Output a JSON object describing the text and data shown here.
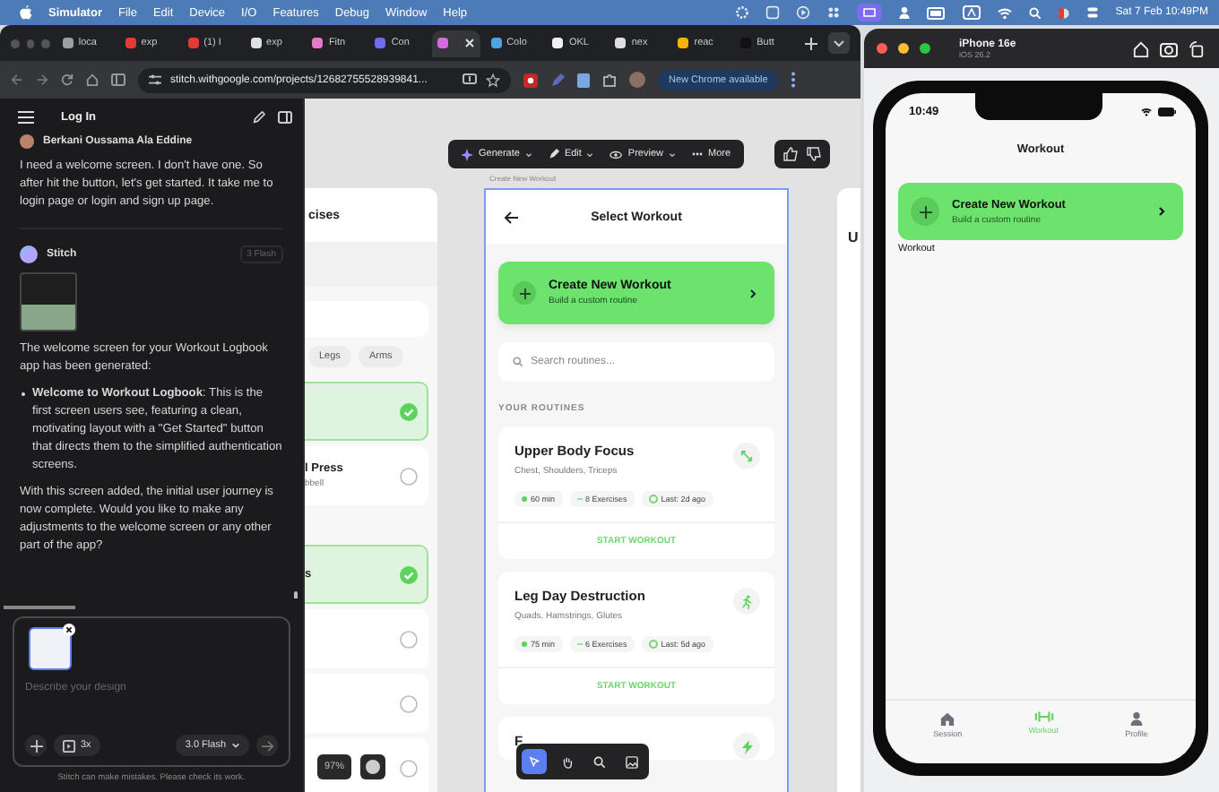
{
  "menubar": {
    "app": "Simulator",
    "menus": [
      "File",
      "Edit",
      "Device",
      "I/O",
      "Features",
      "Debug",
      "Window",
      "Help"
    ],
    "clock": "Sat 7 Feb  10:49PM"
  },
  "browser": {
    "tabs": [
      {
        "label": "loca",
        "color": "#9aa0a6",
        "selected": false
      },
      {
        "label": "exp",
        "color": "#e53935",
        "selected": false
      },
      {
        "label": "(1) I",
        "color": "#e53935",
        "selected": false
      },
      {
        "label": "exp",
        "color": "#e0e0e0",
        "selected": false
      },
      {
        "label": "Fitn",
        "color": "#e879c9",
        "selected": false
      },
      {
        "label": "Con",
        "color": "#6d6df0",
        "selected": false
      },
      {
        "color": "#d66be0",
        "selected": true
      },
      {
        "label": "Colo",
        "color": "#4fa3e0",
        "selected": false
      },
      {
        "label": "OKL",
        "color": "#f1f1f1",
        "selected": false
      },
      {
        "label": "nex",
        "color": "#e0e0e0",
        "selected": false
      },
      {
        "label": "reac",
        "color": "#f4b400",
        "selected": false
      },
      {
        "label": "Butt",
        "color": "#111111",
        "selected": false
      }
    ],
    "url": "stitch.withgoogle.com/projects/12682755528939841...",
    "update_button": "New Chrome available"
  },
  "chat": {
    "title": "Log In",
    "messages": [
      {
        "kind": "user",
        "author": "Berkani Oussama Ala Eddine",
        "text": "I need a welcome screen. I don't have one. So after hit the button, let's get started. It take me to login page or login and sign up page."
      },
      {
        "kind": "assistant",
        "author": "Stitch",
        "badge": "3 Flash",
        "intro": "The welcome screen for your Workout Logbook app has been generated:",
        "bullets": [
          "**Welcome to Workout Logbook**: This is the first screen users see, featuring a clean, motivating layout with a \"Get Started\" button that directs them to the simplified authentication screens."
        ],
        "outro": "With this screen added, the initial user journey is now complete. Would you like to make any adjustments to the welcome screen or any other part of the app?"
      }
    ],
    "composer": {
      "placeholder": "Describe your design",
      "count": "3x",
      "model": "3.0 Flash"
    },
    "disclaimer": "Stitch can make mistakes. Please check its work."
  },
  "canvas": {
    "toolbar": [
      {
        "kind": "generate",
        "label": "Generate"
      },
      {
        "kind": "edit",
        "label": "Edit"
      },
      {
        "kind": "preview",
        "label": "Preview"
      },
      {
        "kind": "more",
        "label": "More"
      }
    ],
    "left_frame": {
      "title": "cises",
      "chips": [
        "Legs",
        "Arms"
      ],
      "items": [
        {
          "checked": true
        },
        {
          "title": "l Press",
          "subtitle": "bbell",
          "checked": false
        },
        {
          "title": "s",
          "checked": true
        },
        {
          "checked": false
        },
        {
          "checked": false
        },
        {
          "checked": false
        }
      ]
    },
    "frame_label": "Create New Workout",
    "main_frame": {
      "title": "Select Workout",
      "create": {
        "title": "Create New Workout",
        "subtitle": "Build a custom routine"
      },
      "search_placeholder": "Search routines...",
      "section": "YOUR ROUTINES",
      "routines": [
        {
          "kind": "expand",
          "name": "Upper Body Focus",
          "muscles": "Chest, Shoulders, Triceps",
          "duration": "60 min",
          "exercises": "8 Exercises",
          "last": "Last: 2d ago",
          "action": "START WORKOUT"
        },
        {
          "kind": "run",
          "name": "Leg Day Destruction",
          "muscles": "Quads, Hamstrings, Glutes",
          "duration": "75 min",
          "exercises": "6 Exercises",
          "last": "Last: 5d ago",
          "action": "START WORKOUT"
        },
        {
          "kind": "bolt",
          "name": "F"
        }
      ]
    },
    "right_frame": {
      "title": "U"
    },
    "zoom": "97%",
    "tools": [
      {
        "kind": "select",
        "selected": true
      },
      {
        "kind": "hand",
        "selected": false
      },
      {
        "kind": "zoom",
        "selected": false
      },
      {
        "kind": "image",
        "selected": false
      }
    ]
  },
  "simulator": {
    "device": "iPhone 16e",
    "os": "iOS 26.2",
    "time": "10:49",
    "nav_title": "Workout",
    "create": {
      "title": "Create New Workout",
      "subtitle": "Build a custom routine"
    },
    "debug_text": "Workout",
    "tabs": [
      {
        "kind": "home",
        "label": "Session",
        "selected": false
      },
      {
        "kind": "dumbbell",
        "label": "Workout",
        "selected": true
      },
      {
        "kind": "person",
        "label": "Profile",
        "selected": false
      }
    ]
  }
}
